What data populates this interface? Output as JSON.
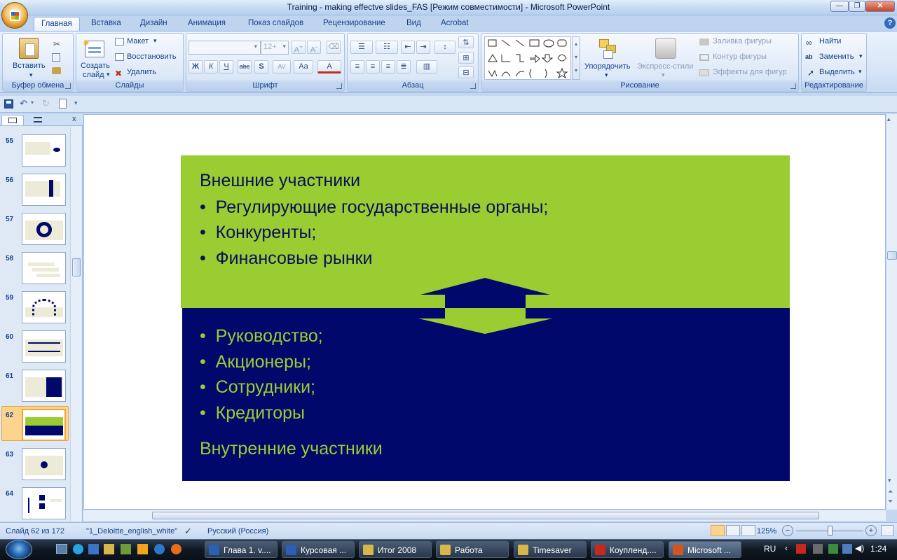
{
  "window": {
    "title": "Training - making effectve slides_FAS [Режим совместимости] - Microsoft PowerPoint"
  },
  "tabs": [
    "Главная",
    "Вставка",
    "Дизайн",
    "Анимация",
    "Показ слайдов",
    "Рецензирование",
    "Вид",
    "Acrobat"
  ],
  "ribbon": {
    "clipboard": {
      "label": "Буфер обмена",
      "paste": "Вставить"
    },
    "slides": {
      "label": "Слайды",
      "new_slide_1": "Создать",
      "new_slide_2": "слайд",
      "layout": "Макет",
      "reset": "Восстановить",
      "delete": "Удалить"
    },
    "font": {
      "label": "Шрифт",
      "size_placeholder": "12+",
      "bold": "Ж",
      "italic": "К",
      "underline": "Ч",
      "strike": "abc",
      "shadow": "S",
      "spacing": "AV",
      "case": "Aa",
      "color": "A"
    },
    "paragraph": {
      "label": "Абзац"
    },
    "drawing": {
      "label": "Рисование",
      "arrange": "Упорядочить",
      "quick_styles": "Экспресс-стили",
      "fill": "Заливка фигуры",
      "outline": "Контур фигуры",
      "effects": "Эффекты для фигур"
    },
    "editing": {
      "label": "Редактирование",
      "find": "Найти",
      "replace": "Заменить",
      "select": "Выделить"
    }
  },
  "thumbnails": [
    "55",
    "56",
    "57",
    "58",
    "59",
    "60",
    "61",
    "62",
    "63",
    "64"
  ],
  "selected_slide": "62",
  "slide": {
    "top_heading": "Внешние участники",
    "top_bullets": [
      "Регулирующие государственные органы;",
      "Конкуренты;",
      "Финансовые рынки"
    ],
    "bottom_bullets": [
      "Руководство;",
      "Акционеры;",
      "Сотрудники;",
      "Кредиторы"
    ],
    "bottom_heading": "Внутренние участники",
    "bullet_char": "•",
    "colors": {
      "green": "#9acd32",
      "navy": "#00086b",
      "dark_text": "#0a0f55"
    }
  },
  "status": {
    "slide_counter": "Слайд 62 из 172",
    "theme": "\"1_Deloitte_english_white\"",
    "language": "Русский (Россия)",
    "zoom": "125%"
  },
  "taskbar": {
    "items": [
      "Глава 1. v....",
      "Курсовая ...",
      "Итог 2008",
      "Работа",
      "Timesaver",
      "Коупленд....",
      "Microsoft ..."
    ],
    "language": "RU",
    "clock": "1:24"
  }
}
